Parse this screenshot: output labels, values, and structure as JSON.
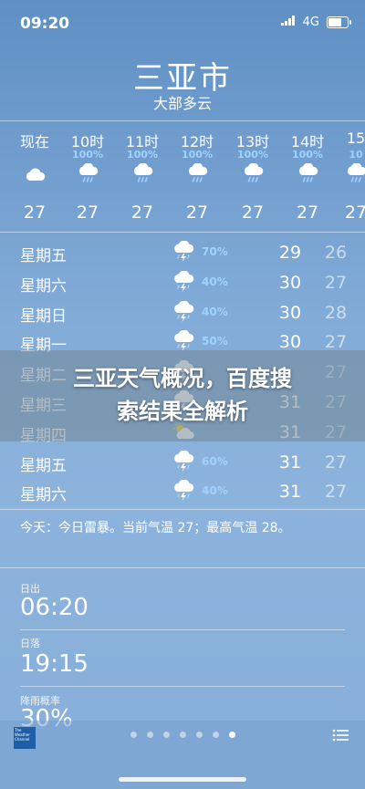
{
  "status_bar": {
    "time": "09:20",
    "network": "4G",
    "battery_level": 0.8
  },
  "header": {
    "city": "三亚市",
    "condition": "大部多云"
  },
  "hourly": [
    {
      "label": "现在",
      "pop": "",
      "icon": "cloud-icon",
      "temp": "27"
    },
    {
      "label": "10时",
      "pop": "100%",
      "icon": "cloud-rain-icon",
      "temp": "27"
    },
    {
      "label": "11时",
      "pop": "100%",
      "icon": "cloud-rain-icon",
      "temp": "27"
    },
    {
      "label": "12时",
      "pop": "100%",
      "icon": "cloud-rain-icon",
      "temp": "27"
    },
    {
      "label": "13时",
      "pop": "100%",
      "icon": "cloud-rain-icon",
      "temp": "27"
    },
    {
      "label": "14时",
      "pop": "100%",
      "icon": "cloud-rain-icon",
      "temp": "27"
    },
    {
      "label": "15",
      "pop": "10",
      "icon": "cloud-rain-icon",
      "temp": "27"
    }
  ],
  "daily": [
    {
      "day": "星期五",
      "icon": "thunderstorm-icon",
      "pop": "70%",
      "hi": "29",
      "lo": "26"
    },
    {
      "day": "星期六",
      "icon": "thunderstorm-icon",
      "pop": "40%",
      "hi": "30",
      "lo": "27"
    },
    {
      "day": "星期日",
      "icon": "thunderstorm-icon",
      "pop": "40%",
      "hi": "30",
      "lo": "28"
    },
    {
      "day": "星期一",
      "icon": "thunderstorm-icon",
      "pop": "50%",
      "hi": "30",
      "lo": "27"
    },
    {
      "day": "星期二",
      "icon": "thunderstorm-icon",
      "pop": "",
      "hi": "",
      "lo": "27"
    },
    {
      "day": "星期三",
      "icon": "thunderstorm-icon",
      "pop": "",
      "hi": "31",
      "lo": "27"
    },
    {
      "day": "星期四",
      "icon": "partly-sunny-icon",
      "pop": "",
      "hi": "31",
      "lo": "27"
    },
    {
      "day": "星期五",
      "icon": "thunderstorm-icon",
      "pop": "60%",
      "hi": "31",
      "lo": "27"
    },
    {
      "day": "星期六",
      "icon": "thunderstorm-icon",
      "pop": "40%",
      "hi": "31",
      "lo": "27"
    }
  ],
  "overlay": {
    "line1": "三亚天气概况，百度搜",
    "line2": "索结果全解析"
  },
  "summary": "今天：今日雷暴。当前气温 27；最高气温 28。",
  "details": {
    "sunrise_label": "日出",
    "sunrise": "06:20",
    "sunset_label": "日落",
    "sunset": "19:15",
    "rain_label": "降雨概率",
    "rain": "30%"
  },
  "bottom_bar": {
    "logo_text": "The Weather Channel",
    "page_count": 7,
    "active_page": 7
  },
  "colors": {
    "precip": "#9fd3ff",
    "bg_top": "#5f8fc4",
    "bg_bottom": "#86afd9"
  }
}
